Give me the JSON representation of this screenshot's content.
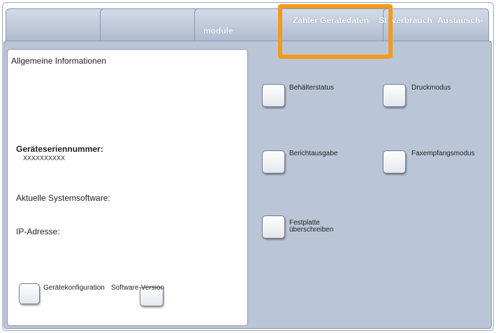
{
  "tabs": [
    {
      "label": ""
    },
    {
      "label": "module"
    },
    {
      "label_a": "Zähler",
      "label_b": "Gerätedaten",
      "label_c": "St",
      "label_d": "Verbrauch",
      "label_e": "Austausch-"
    }
  ],
  "info": {
    "heading": "Allgemeine Informationen",
    "serial_label": "Geräteseriennummer:",
    "serial_value": "XXXXXXXXXX",
    "software_label": "Aktuelle Systemsoftware:",
    "ip_label": "IP-Adresse:",
    "config_button_label": "Gerätekonfiguration",
    "software_version_label": "Software-Version"
  },
  "actions": {
    "behaelterstatus": "Behälterstatus",
    "druckmodus": "Druckmodus",
    "berichtausgabe": "Berichtausgabe",
    "faxempfangsmodus": "Faxempfangsmodus",
    "festplatte_line1": "Festplatte",
    "festplatte_line2": "überschreiben"
  },
  "colors": {
    "highlight": "#f39a1c",
    "panel_bg": "#bac6d8",
    "tab_bg": "#a8b6cc"
  }
}
